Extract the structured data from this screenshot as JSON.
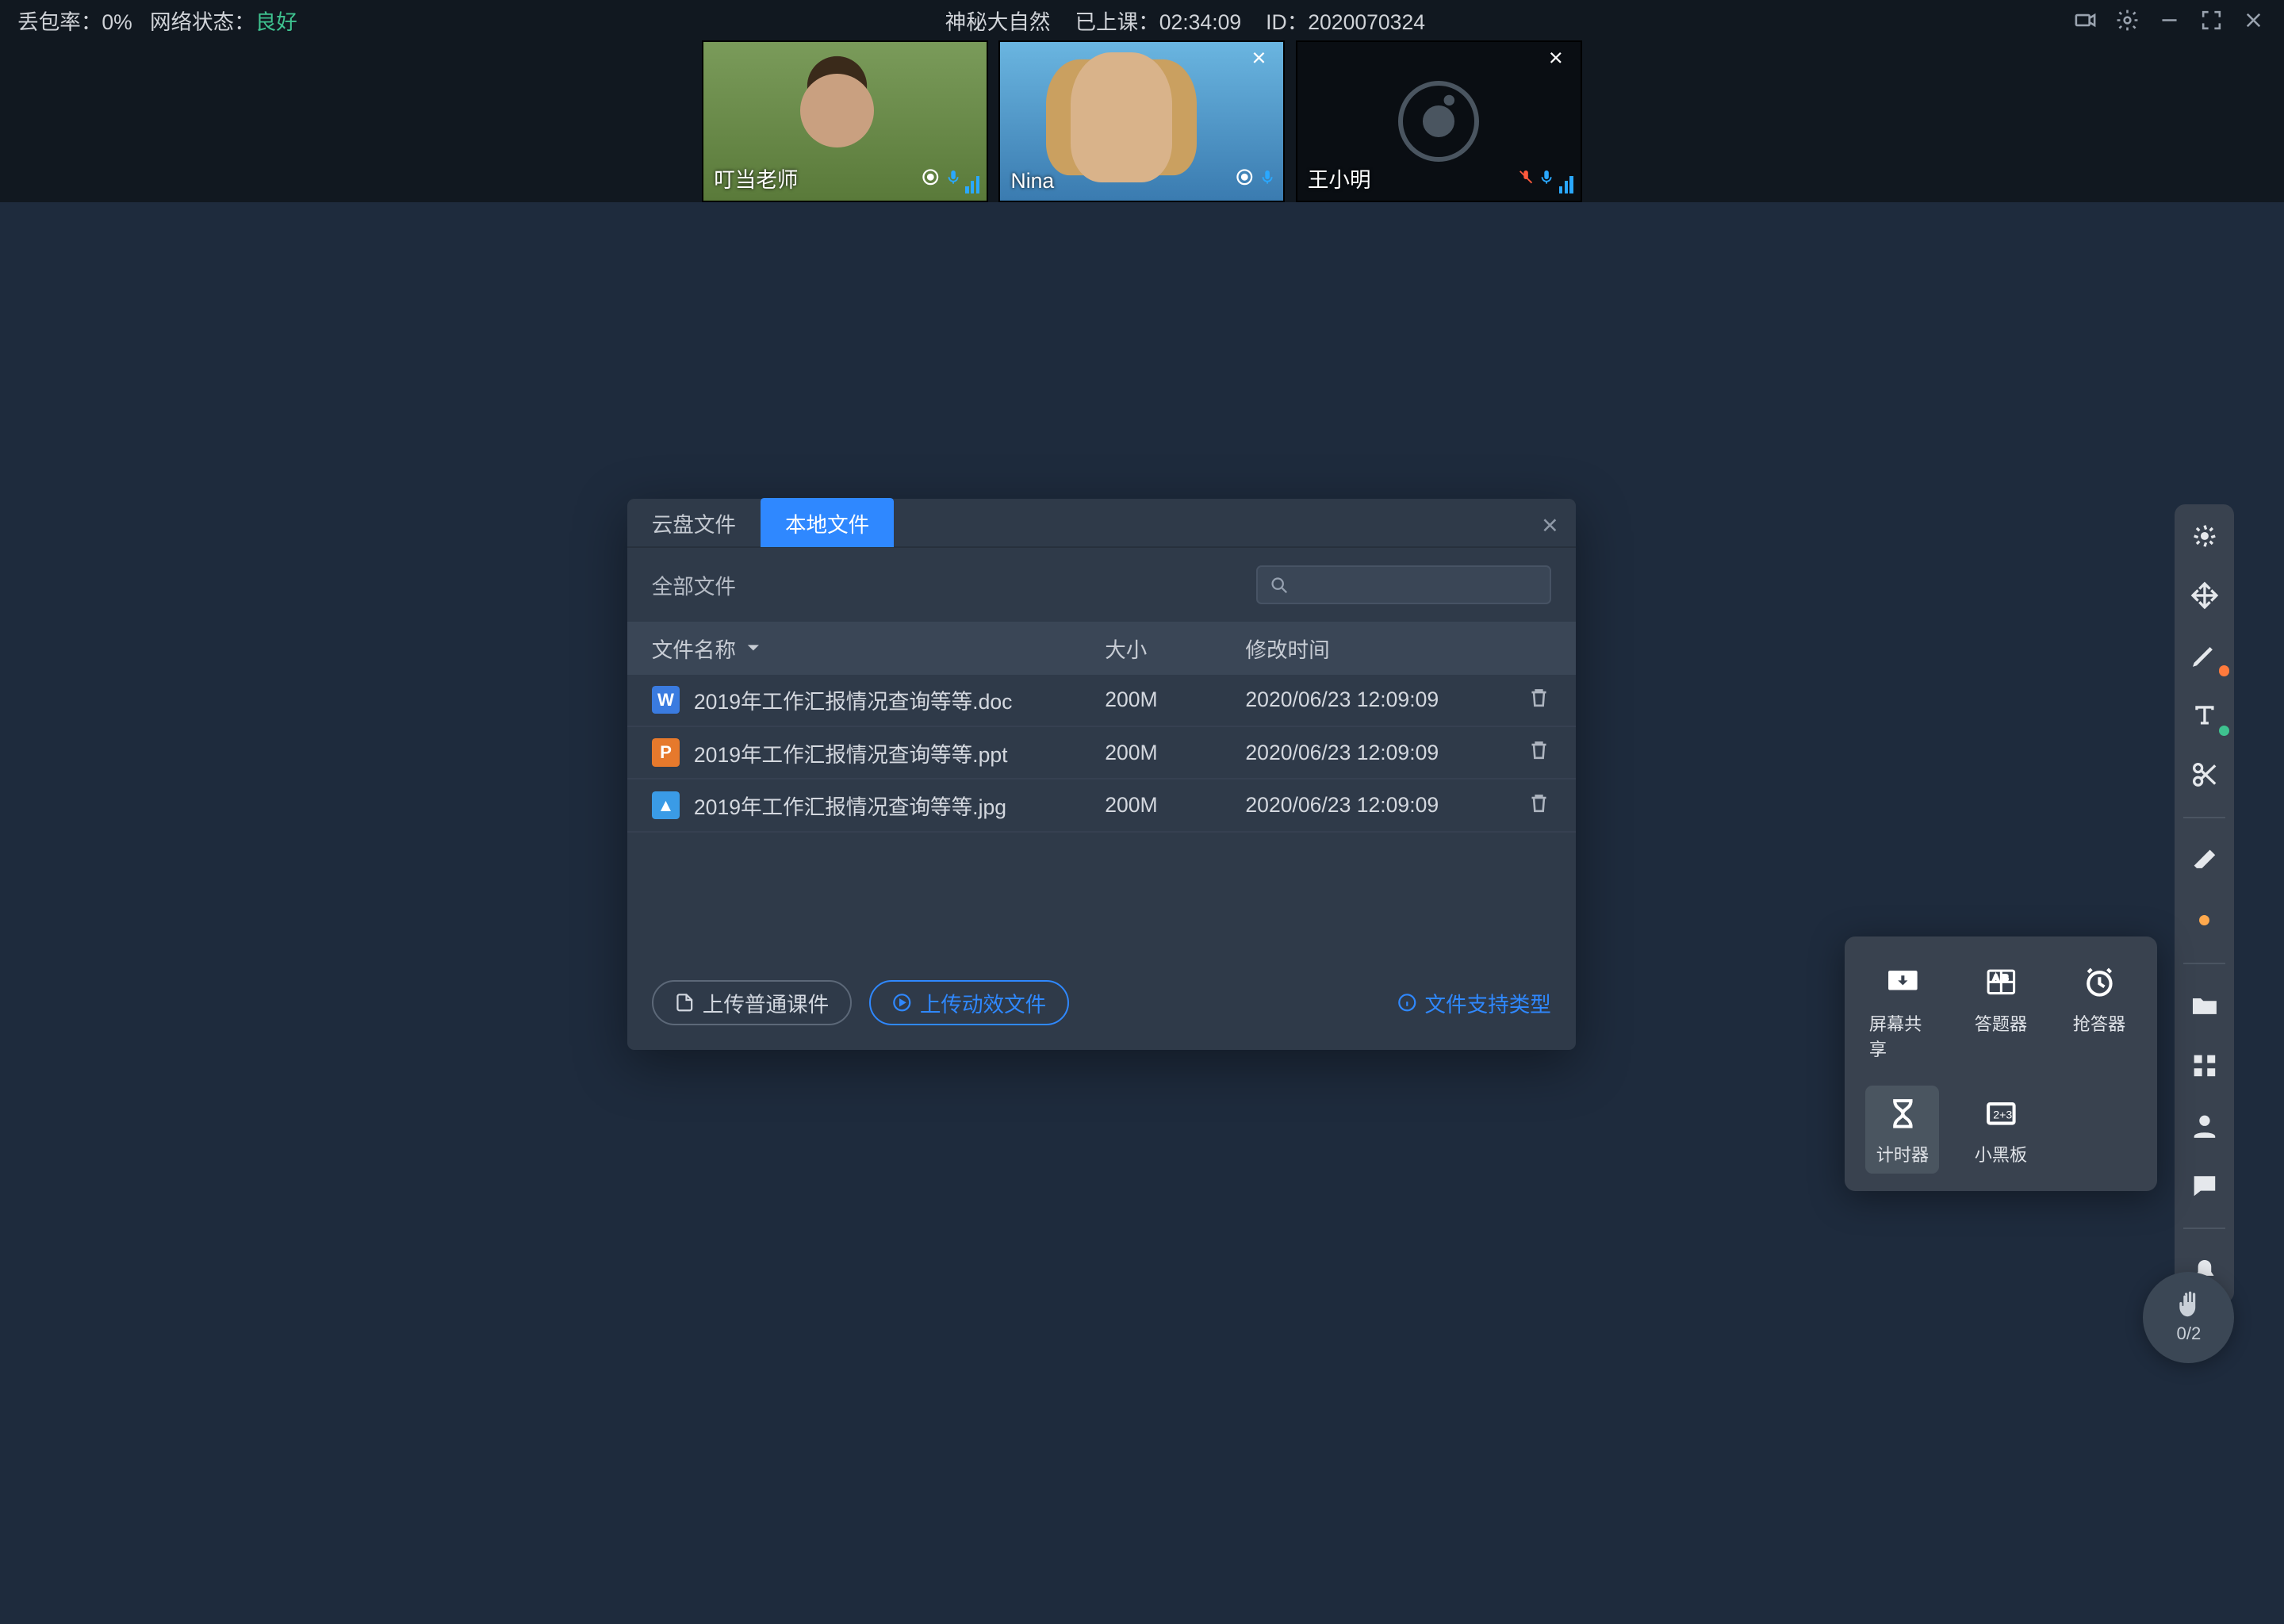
{
  "topbar": {
    "loss_label": "丢包率：",
    "loss_value": "0%",
    "net_label": "网络状态：",
    "net_value": "良好",
    "title": "神秘大自然",
    "elapsed_label": "已上课：",
    "elapsed_value": "02:34:09",
    "id_label": "ID：",
    "id_value": "2020070324"
  },
  "videos": [
    {
      "name": "叮当老师",
      "mic": "on",
      "cam": "on",
      "closable": false
    },
    {
      "name": "Nina",
      "mic": "on",
      "cam": "on",
      "closable": true
    },
    {
      "name": "王小明",
      "mic": "on",
      "cam": "off",
      "closable": true
    }
  ],
  "dialog": {
    "tab_cloud": "云盘文件",
    "tab_local": "本地文件",
    "all_files": "全部文件",
    "col_name": "文件名称",
    "col_size": "大小",
    "col_mtime": "修改时间",
    "files": [
      {
        "type": "doc",
        "icon": "W",
        "name": "2019年工作汇报情况查询等等.doc",
        "size": "200M",
        "mtime": "2020/06/23 12:09:09"
      },
      {
        "type": "ppt",
        "icon": "P",
        "name": "2019年工作汇报情况查询等等.ppt",
        "size": "200M",
        "mtime": "2020/06/23 12:09:09"
      },
      {
        "type": "jpg",
        "icon": "▲",
        "name": "2019年工作汇报情况查询等等.jpg",
        "size": "200M",
        "mtime": "2020/06/23 12:09:09"
      }
    ],
    "btn_normal": "上传普通课件",
    "btn_anim": "上传动效文件",
    "link_types": "文件支持类型"
  },
  "pop": {
    "screen": "屏幕共享",
    "quiz": "答题器",
    "buzzer": "抢答器",
    "timer": "计时器",
    "board": "小黑板"
  },
  "fab": {
    "count": "0/2"
  }
}
